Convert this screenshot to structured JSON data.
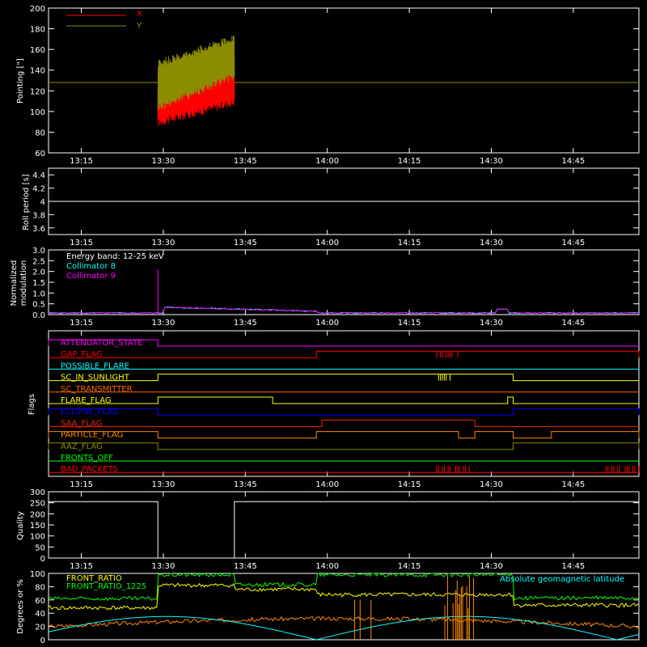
{
  "chart_data": [
    {
      "type": "line",
      "ylabel": "Pointing [\"]",
      "ylim": [
        60,
        200
      ],
      "yticks": [
        60,
        80,
        100,
        120,
        140,
        160,
        180,
        200
      ],
      "xticks": [
        "13:15",
        "13:30",
        "13:45",
        "14:00",
        "14:15",
        "14:30",
        "14:45"
      ],
      "legend": {
        "placement": "top-left"
      },
      "series": [
        {
          "name": "X",
          "color": "#ff0000",
          "t_start": "13:29",
          "t_end": "13:43",
          "lo_start": 85,
          "lo_end": 105,
          "hi_start": 135,
          "hi_end": 160
        },
        {
          "name": "Y",
          "color": "#8c8c00",
          "t_start": "13:29",
          "t_end": "13:43",
          "lo_start": 100,
          "lo_end": 130,
          "hi_start": 150,
          "hi_end": 175
        },
        {
          "name": "",
          "color": "#8c8c00",
          "constant": 128
        }
      ]
    },
    {
      "type": "line",
      "ylabel": "Roll period [s]",
      "ylim": [
        3.5,
        4.5
      ],
      "yticks": [
        3.6,
        3.8,
        4.0,
        4.2,
        4.4
      ],
      "xticks": [
        "13:15",
        "13:30",
        "13:45",
        "14:00",
        "14:15",
        "14:30",
        "14:45"
      ],
      "series": [
        {
          "name": "",
          "color": "#ffffff",
          "constant": 4.0
        }
      ]
    },
    {
      "type": "line",
      "ylabel": "Normalized modulation",
      "ylim": [
        0,
        3.0
      ],
      "yticks": [
        "0.0",
        "0.5",
        "1.0",
        "1.5",
        "2.0",
        "2.5",
        "3.0"
      ],
      "xticks": [
        "13:15",
        "13:30",
        "13:45",
        "14:00",
        "14:15",
        "14:30",
        "14:45"
      ],
      "legend_title": "Energy band: 12-25 keV",
      "series": [
        {
          "name": "Collimator 8",
          "color": "#00ffff"
        },
        {
          "name": "Collimator 9",
          "color": "#ff00ff"
        }
      ]
    },
    {
      "type": "line",
      "ylabel": "Flags",
      "xticks": [
        "13:15",
        "13:30",
        "13:45",
        "14:00",
        "14:15",
        "14:30",
        "14:45"
      ],
      "flags": [
        {
          "name": "ATTENUATOR_STATE",
          "color": "#ff00ff"
        },
        {
          "name": "GAP_FLAG",
          "color": "#ff0000"
        },
        {
          "name": "POSSIBLE_FLARE",
          "color": "#00ffff"
        },
        {
          "name": "SC_IN_SUNLIGHT",
          "color": "#ffff00"
        },
        {
          "name": "SC_TRANSMITTER",
          "color": "#ff6600"
        },
        {
          "name": "FLARE_FLAG",
          "color": "#ffff00"
        },
        {
          "name": "ECLIPSE_FLAG",
          "color": "#0000ff"
        },
        {
          "name": "SAA_FLAG",
          "color": "#ff2200"
        },
        {
          "name": "PARTICLE_FLAG",
          "color": "#ff8800"
        },
        {
          "name": "AAZ_FLAG",
          "color": "#8c8c00"
        },
        {
          "name": "FRONTS_OFF",
          "color": "#00ff00"
        },
        {
          "name": "BAD_PACKETS",
          "color": "#ff0000"
        }
      ]
    },
    {
      "type": "line",
      "ylabel": "Quality",
      "ylim": [
        0,
        300
      ],
      "yticks": [
        0,
        50,
        100,
        150,
        200,
        250,
        300
      ],
      "xticks": [
        "13:15",
        "13:30",
        "13:45",
        "14:00",
        "14:15",
        "14:30",
        "14:45"
      ],
      "series": [
        {
          "name": "",
          "color": "#ffffff",
          "segments": [
            {
              "t_start": "13:09",
              "t_end": "13:29",
              "value": 255
            },
            {
              "t_start": "13:29",
              "t_end": "13:43",
              "value": 0
            },
            {
              "t_start": "13:43",
              "t_end": "14:57",
              "value": 255
            }
          ]
        }
      ]
    },
    {
      "type": "line",
      "ylabel": "Degrees or %",
      "ylim": [
        0,
        100
      ],
      "yticks": [
        0,
        20,
        40,
        60,
        80,
        100
      ],
      "series": [
        {
          "name": "FRONT_RATIO",
          "color": "#ffff00"
        },
        {
          "name": "FRONT_RATIO_1225",
          "color": "#00ff00"
        },
        {
          "name": "",
          "color": "#ff8800"
        },
        {
          "name": "Absolute geomagnetic latitude",
          "color": "#00ffff"
        }
      ]
    }
  ]
}
